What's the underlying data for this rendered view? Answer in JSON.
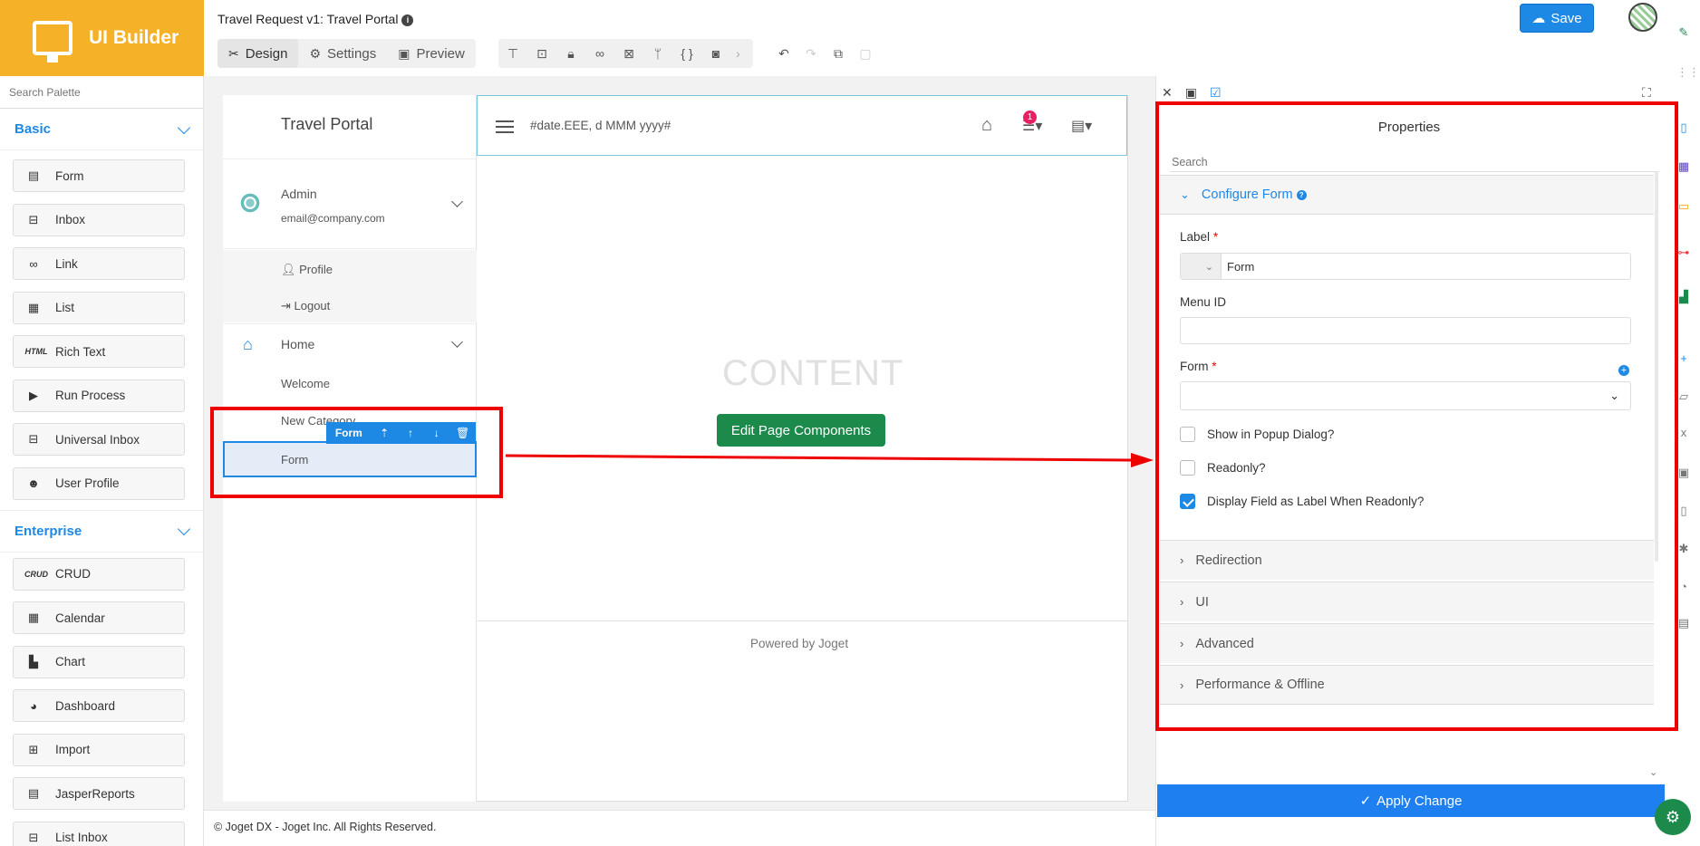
{
  "brand": {
    "title": "UI Builder"
  },
  "palette": {
    "search_placeholder": "Search Palette",
    "sections": [
      {
        "title": "Basic",
        "items": [
          "Form",
          "Inbox",
          "Link",
          "List",
          "Rich Text",
          "Run Process",
          "Universal Inbox",
          "User Profile"
        ]
      },
      {
        "title": "Enterprise",
        "items": [
          "CRUD",
          "Calendar",
          "Chart",
          "Dashboard",
          "Import",
          "JasperReports",
          "List Inbox"
        ]
      }
    ],
    "small_icon_text": {
      "rich_text": "HTML",
      "crud": "CRUD"
    }
  },
  "header": {
    "app_title": "Travel Request v1: Travel Portal",
    "tabs": [
      "Design",
      "Settings",
      "Preview"
    ],
    "save_label": "Save"
  },
  "canvas": {
    "portal_title": "Travel Portal",
    "admin_name": "Admin",
    "admin_email": "email@company.com",
    "profile": "Profile",
    "logout": "Logout",
    "home": "Home",
    "welcome": "Welcome",
    "new_category": "New Category",
    "form_item": "Form",
    "form_toolbar_label": "Form",
    "date_format": "#date.EEE, d MMM yyyy#",
    "notification_count": "1",
    "content_text": "CONTENT",
    "edit_button": "Edit Page Components",
    "powered_by": "Powered by Joget",
    "copyright": "© Joget DX - Joget Inc. All Rights Reserved."
  },
  "properties": {
    "title": "Properties",
    "search_placeholder": "Search",
    "configure_section": "Configure Form",
    "label_field": "Label",
    "label_value": "Form",
    "menu_id_field": "Menu ID",
    "form_field": "Form",
    "checkboxes": [
      {
        "label": "Show in Popup Dialog?",
        "checked": false
      },
      {
        "label": "Readonly?",
        "checked": false
      },
      {
        "label": "Display Field as Label When Readonly?",
        "checked": true
      }
    ],
    "sections": [
      "Redirection",
      "UI",
      "Advanced",
      "Performance & Offline"
    ],
    "apply_label": "Apply Change"
  },
  "colors": {
    "brand": "#f5b229",
    "accent": "#1e88e5",
    "edit_button": "#1c8a4b",
    "highlight": "#e00000"
  }
}
